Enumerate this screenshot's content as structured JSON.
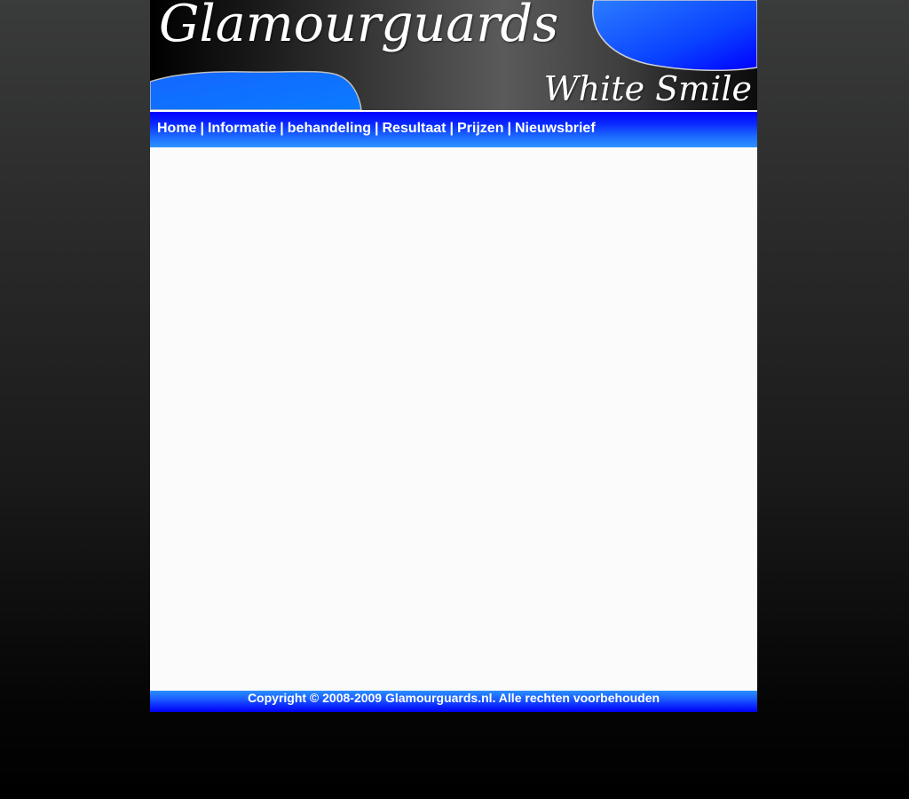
{
  "header": {
    "site_title": "Glamourguards",
    "tagline": "White Smile"
  },
  "nav": {
    "items": [
      {
        "label": "Home"
      },
      {
        "label": "Informatie"
      },
      {
        "label": "behandeling"
      },
      {
        "label": "Resultaat"
      },
      {
        "label": "Prijzen"
      },
      {
        "label": "Nieuwsbrief"
      }
    ],
    "separator": "|"
  },
  "footer": {
    "copyright": "Copyright © 2008-2009 Glamourguards.nl. Alle rechten voorbehouden"
  },
  "colors": {
    "brand_blue": "#0000ff",
    "accent_blue": "#1e7bff",
    "content_bg": "#fbfbfb",
    "header_dark": "#000000"
  }
}
